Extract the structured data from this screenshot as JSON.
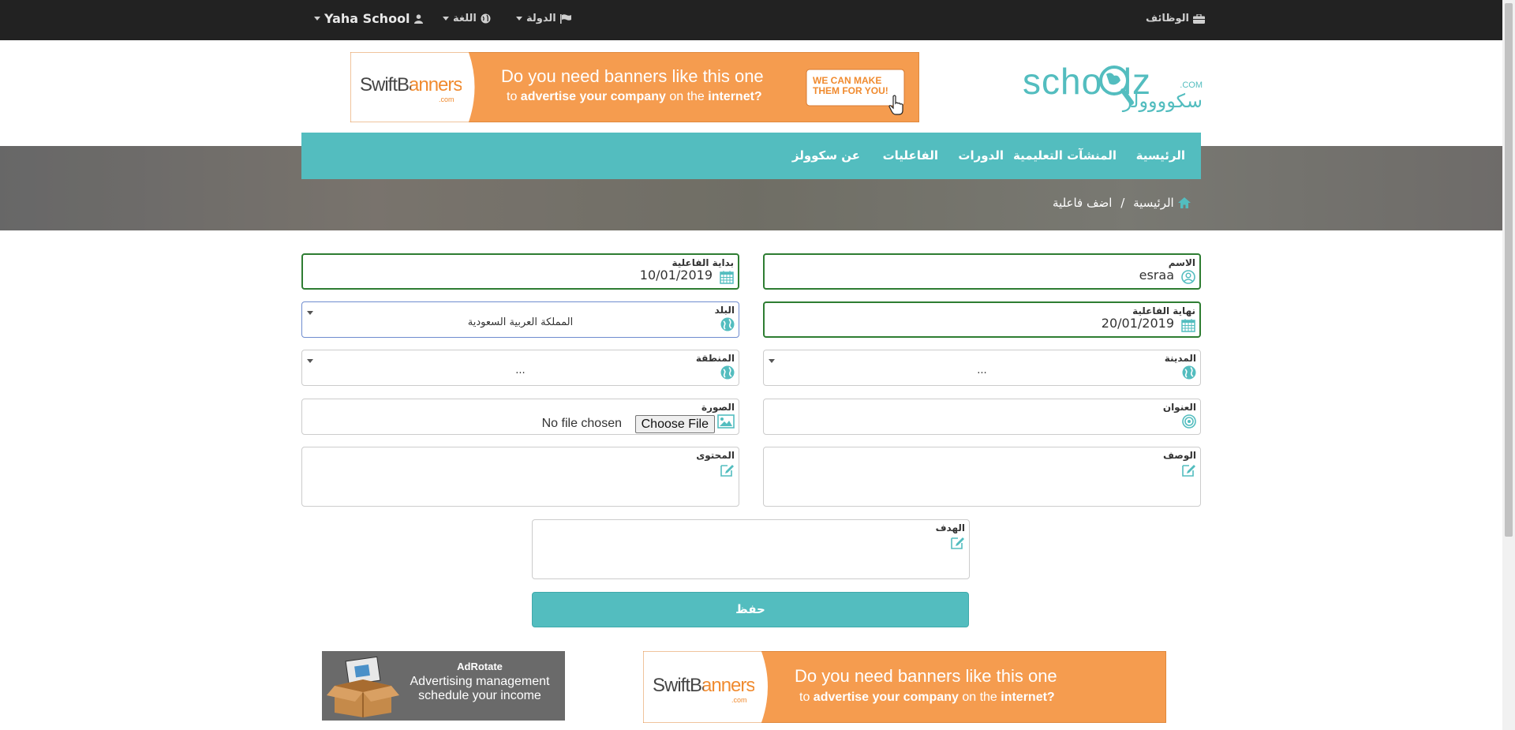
{
  "topbar": {
    "jobs_label": "الوظائف",
    "country_label": "الدولة",
    "language_label": "اللغة",
    "user_label": "Yaha School"
  },
  "ads": {
    "top_banner": {
      "brand": "SwiftBanners",
      "brand_sub": ".com",
      "headline": "Do you need banners like this one",
      "subline_prefix": "to ",
      "subline_bold1": "advertise your company",
      "subline_mid": " on the ",
      "subline_bold2": "internet?",
      "cta_line1": "WE CAN MAKE",
      "cta_line2": "THEM FOR YOU!",
      "accent": "#f59c4f"
    },
    "adrotate": {
      "title": "AdRotate",
      "line1": "Advertising management",
      "line2": "schedule your income"
    },
    "bottom_banner": {
      "brand": "SwiftBanners",
      "brand_sub": ".com",
      "headline": "Do you need banners like this one",
      "subline_prefix": "to ",
      "subline_bold1": "advertise your company",
      "subline_mid": " on the ",
      "subline_bold2": "internet?"
    }
  },
  "logo": {
    "latin": "schoolz",
    "com": ".COM",
    "arabic": "سكوووولز",
    "color": "#53bdbf"
  },
  "nav": {
    "home": "الرئيسية",
    "institutions": "المنشآت التعليمية",
    "courses": "الدورات",
    "events": "الفاعليات",
    "about": "عن سكوولز",
    "color": "#53bdbf"
  },
  "breadcrumb": {
    "home": "الرئيسية",
    "sep": "/",
    "current": "اضف فاعلية"
  },
  "form": {
    "name": {
      "label": "الاسم",
      "value": "esraa",
      "icon": "user-icon"
    },
    "start": {
      "label": "بداية الفاعلية",
      "value": "10/01/2019",
      "icon": "calendar-icon"
    },
    "end": {
      "label": "نهاية الفاعلية",
      "value": "20/01/2019",
      "icon": "calendar-icon"
    },
    "country": {
      "label": "البلد",
      "value": "المملكة العربية السعودية",
      "icon": "globe-icon"
    },
    "city": {
      "label": "المدينة",
      "value": "...",
      "icon": "globe-icon"
    },
    "region": {
      "label": "المنطقة",
      "value": "...",
      "icon": "globe-icon"
    },
    "address": {
      "label": "العنوان",
      "icon": "target-icon"
    },
    "image": {
      "label": "الصورة",
      "button": "Choose File",
      "status": "No file chosen",
      "icon": "image-icon"
    },
    "description": {
      "label": "الوصف",
      "icon": "edit-icon"
    },
    "content": {
      "label": "المحتوى",
      "icon": "edit-icon"
    },
    "goal": {
      "label": "الهدف",
      "icon": "edit-icon"
    },
    "save_label": "حفظ"
  }
}
